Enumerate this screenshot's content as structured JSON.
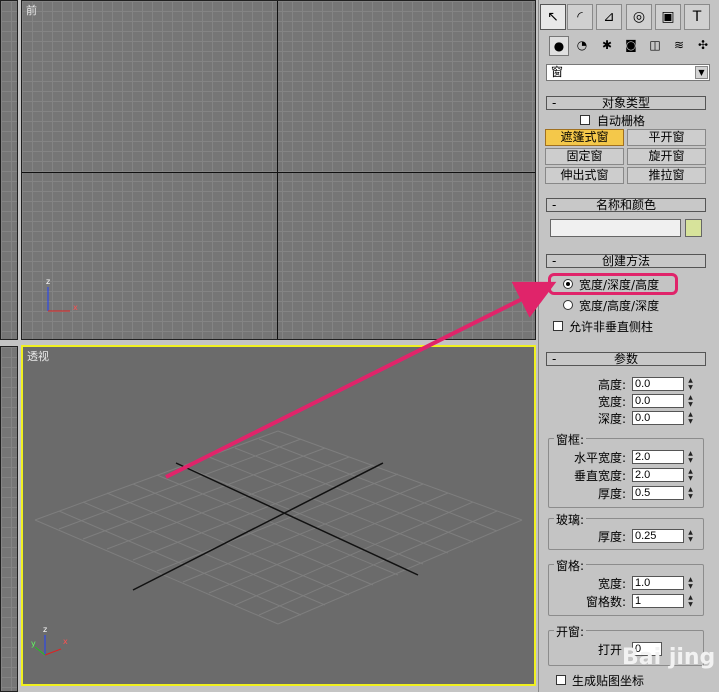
{
  "viewports": {
    "front_label": "前",
    "perspective_label": "透视",
    "axis_z": "z",
    "axis_x": "x",
    "axis_y": "y"
  },
  "command_panel": {
    "tabs": [
      "create-tab",
      "modify-tab",
      "hierarchy-tab",
      "motion-tab",
      "display-tab",
      "utilities-tab"
    ],
    "category_dropdown": "窗",
    "object_type": {
      "header": "对象类型",
      "autogrid": "自动栅格",
      "buttons": [
        "遮篷式窗",
        "平开窗",
        "固定窗",
        "旋开窗",
        "伸出式窗",
        "推拉窗"
      ]
    },
    "name_color": {
      "header": "名称和颜色",
      "name_value": "",
      "swatch_color": "#d7e39b"
    },
    "creation_method": {
      "header": "创建方法",
      "option1": "宽度/深度/高度",
      "option2": "宽度/高度/深度",
      "non_vertical": "允许非垂直侧柱"
    },
    "parameters": {
      "header": "参数",
      "height_label": "高度:",
      "height_value": "0.0",
      "width_label": "宽度:",
      "width_value": "0.0",
      "depth_label": "深度:",
      "depth_value": "0.0",
      "frame_title": "窗框:",
      "horiz_width_label": "水平宽度:",
      "horiz_width_value": "2.0",
      "vert_width_label": "垂直宽度:",
      "vert_width_value": "2.0",
      "frame_thickness_label": "厚度:",
      "frame_thickness_value": "0.5",
      "glass_title": "玻璃:",
      "glass_thickness_label": "厚度:",
      "glass_thickness_value": "0.25",
      "pane_title": "窗格:",
      "pane_width_label": "宽度:",
      "pane_width_value": "1.0",
      "pane_count_label": "窗格数:",
      "pane_count_value": "1",
      "open_title": "开窗:",
      "open_label": "打开",
      "open_value": "0",
      "gen_mapping": "生成贴图坐标"
    }
  },
  "watermark": "Bai jing",
  "colors": {
    "highlight": "#e0246a",
    "active_button": "#f4c84a",
    "viewport_active_border": "#f0f020"
  }
}
